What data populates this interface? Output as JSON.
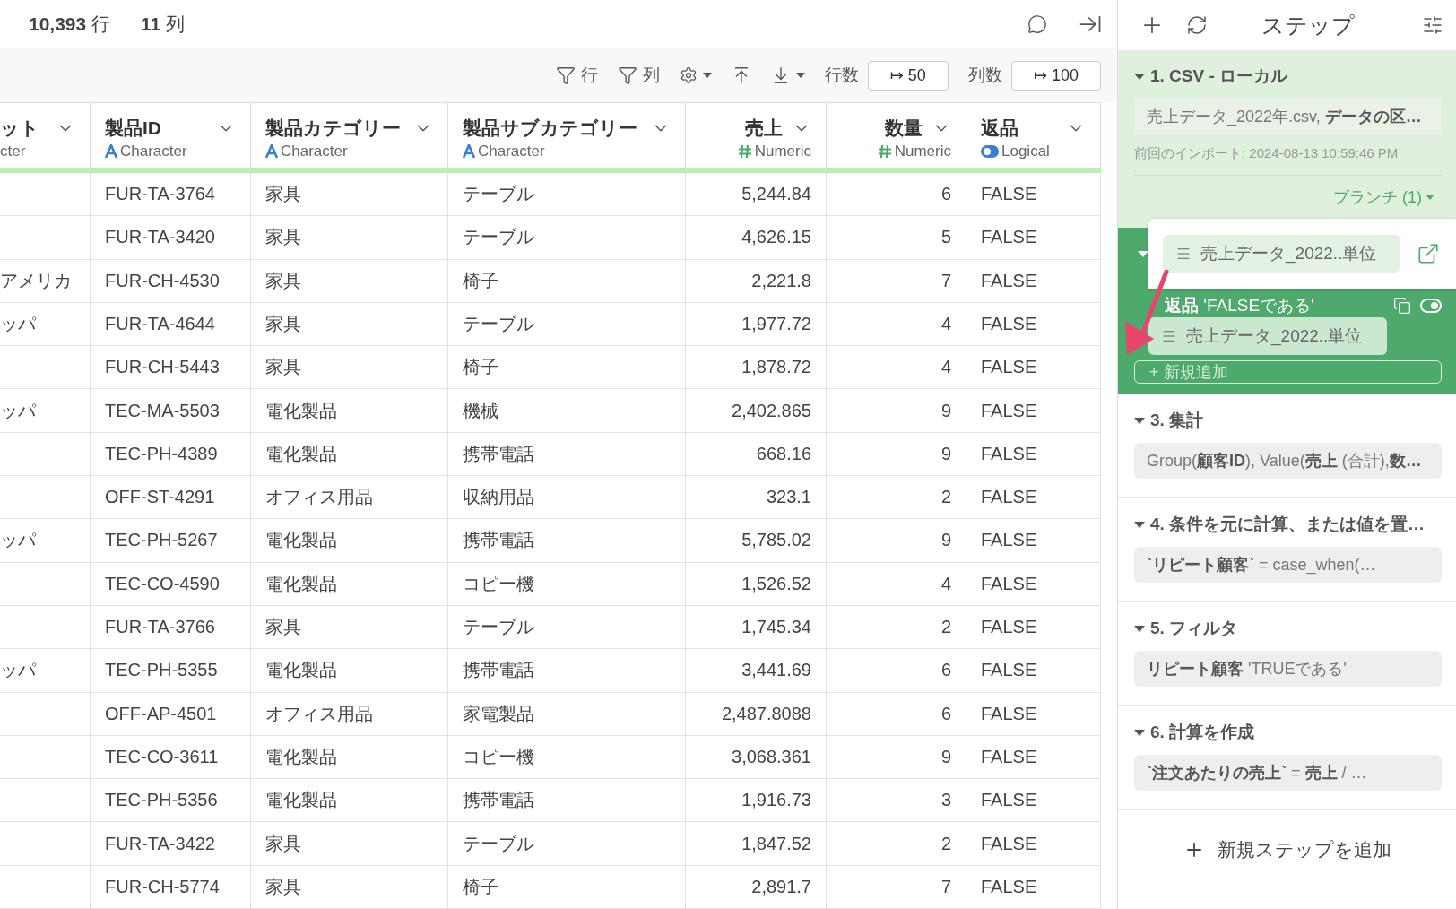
{
  "summary": {
    "rows": "**10,393** 行",
    "cols": "**11** 列"
  },
  "toolbar": {
    "filter_rows": "行",
    "filter_cols": "列",
    "row_count_label": "行数",
    "row_count": "↦ 50",
    "col_count_label": "列数",
    "col_count": "↦ 100"
  },
  "table": {
    "columns": [
      {
        "name": "ット",
        "type": "cter"
      },
      {
        "name": "製品ID",
        "type": "Character",
        "kind": "character"
      },
      {
        "name": "製品カテゴリー",
        "type": "Character",
        "kind": "character"
      },
      {
        "name": "製品サブカテゴリー",
        "type": "Character",
        "kind": "character"
      },
      {
        "name": "売上",
        "type": "Numeric",
        "kind": "numeric"
      },
      {
        "name": "数量",
        "type": "Numeric",
        "kind": "numeric"
      },
      {
        "name": "返品",
        "type": "Logical",
        "kind": "logical"
      }
    ],
    "rows": [
      [
        "",
        "FUR-TA-3764",
        "家具",
        "テーブル",
        "5,244.84",
        "6",
        "FALSE"
      ],
      [
        "",
        "FUR-TA-3420",
        "家具",
        "テーブル",
        "4,626.15",
        "5",
        "FALSE"
      ],
      [
        "アメリカ",
        "FUR-CH-4530",
        "家具",
        "椅子",
        "2,221.8",
        "7",
        "FALSE"
      ],
      [
        "ッパ",
        "FUR-TA-4644",
        "家具",
        "テーブル",
        "1,977.72",
        "4",
        "FALSE"
      ],
      [
        "",
        "FUR-CH-5443",
        "家具",
        "椅子",
        "1,878.72",
        "4",
        "FALSE"
      ],
      [
        "ッパ",
        "TEC-MA-5503",
        "電化製品",
        "機械",
        "2,402.865",
        "9",
        "FALSE"
      ],
      [
        "",
        "TEC-PH-4389",
        "電化製品",
        "携帯電話",
        "668.16",
        "9",
        "FALSE"
      ],
      [
        "",
        "OFF-ST-4291",
        "オフィス用品",
        "収納用品",
        "323.1",
        "2",
        "FALSE"
      ],
      [
        "ッパ",
        "TEC-PH-5267",
        "電化製品",
        "携帯電話",
        "5,785.02",
        "9",
        "FALSE"
      ],
      [
        "",
        "TEC-CO-4590",
        "電化製品",
        "コピー機",
        "1,526.52",
        "4",
        "FALSE"
      ],
      [
        "",
        "FUR-TA-3766",
        "家具",
        "テーブル",
        "1,745.34",
        "2",
        "FALSE"
      ],
      [
        "ッパ",
        "TEC-PH-5355",
        "電化製品",
        "携帯電話",
        "3,441.69",
        "6",
        "FALSE"
      ],
      [
        "",
        "OFF-AP-4501",
        "オフィス用品",
        "家電製品",
        "2,487.8088",
        "6",
        "FALSE"
      ],
      [
        "",
        "TEC-CO-3611",
        "電化製品",
        "コピー機",
        "3,068.361",
        "9",
        "FALSE"
      ],
      [
        "",
        "TEC-PH-5356",
        "電化製品",
        "携帯電話",
        "1,916.73",
        "3",
        "FALSE"
      ],
      [
        "",
        "FUR-TA-3422",
        "家具",
        "テーブル",
        "1,847.52",
        "2",
        "FALSE"
      ],
      [
        "",
        "FUR-CH-5774",
        "家具",
        "椅子",
        "2,891.7",
        "7",
        "FALSE"
      ]
    ]
  },
  "steps_panel": {
    "title": "ステップ",
    "steps": [
      {
        "kind": "source",
        "expanded": true,
        "title": "1. CSV - ローカル",
        "chip": "売上データ_2022年.csv, **データの区…**",
        "note": "前回のインポート: 2024-08-13 10:59:46 PM",
        "branch": "ブランチ (1)"
      },
      {
        "kind": "current",
        "expanded": true,
        "chip": "**返品** 'FALSEである'",
        "add": "+ 新規追加",
        "visible": true
      },
      {
        "kind": "plain",
        "expanded": true,
        "title": "3. 集計",
        "chip": "Group(**顧客ID**), Value(**売上** (合計),**数…**"
      },
      {
        "kind": "plain",
        "expanded": true,
        "title": "4. 条件を元に計算、または値を置…",
        "chip": "**`リピート顧客`** = case_when(…"
      },
      {
        "kind": "plain",
        "expanded": true,
        "title": "5. フィルタ",
        "chip": "**リピート顧客** 'TRUEである'"
      },
      {
        "kind": "plain",
        "expanded": true,
        "title": "6. 計算を作成",
        "chip": "**`注文あたりの売上`** = **売上** / …"
      }
    ],
    "branch_menu": {
      "item": "売上データ_2022..単位"
    },
    "dragged_item": "売上データ_2022..単位",
    "add_step": "新規ステップを追加"
  }
}
